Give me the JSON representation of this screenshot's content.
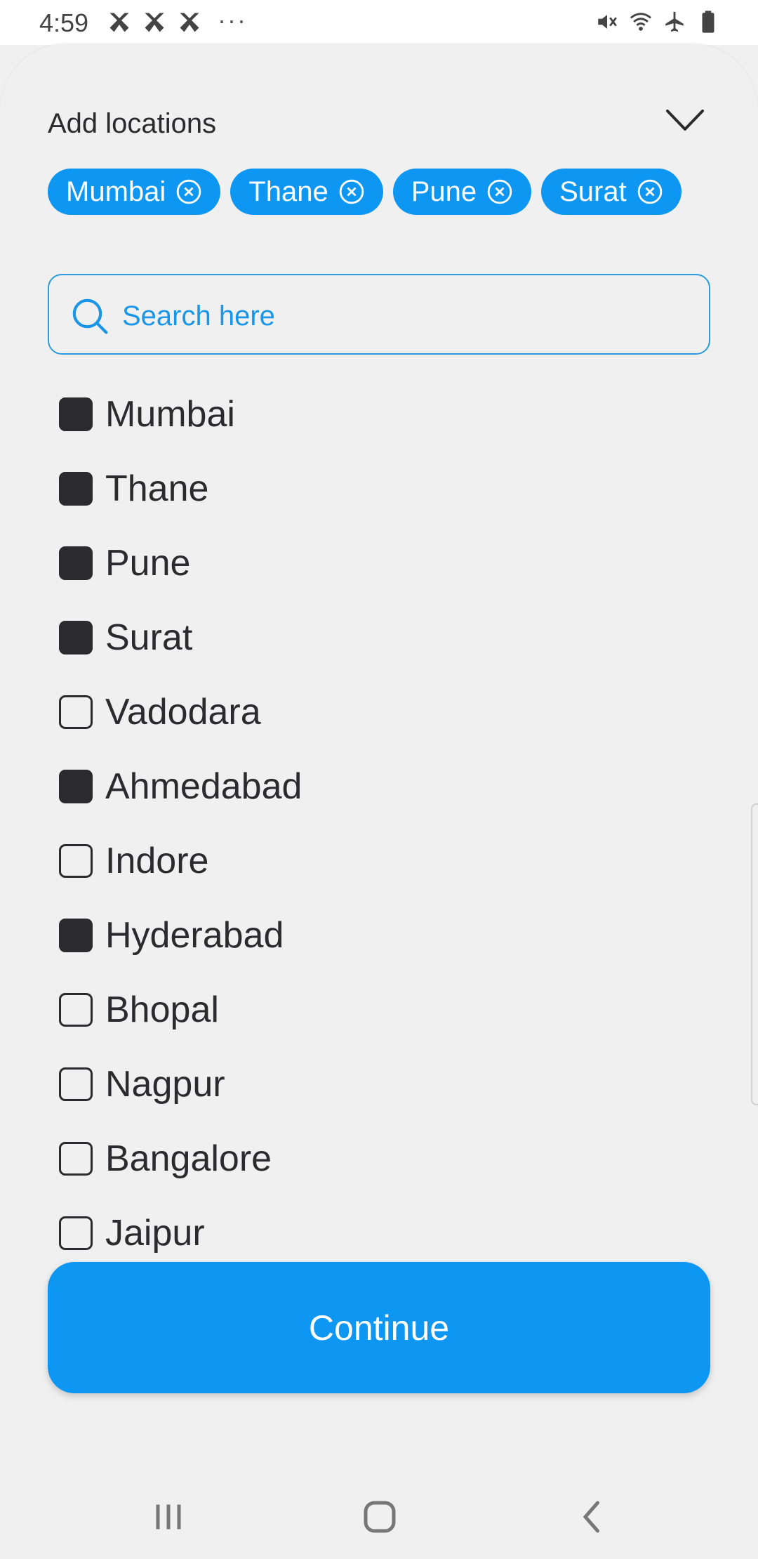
{
  "status_bar": {
    "time": "4:59",
    "notification_icons": [
      "app-notification-icon",
      "app-notification-icon",
      "app-notification-icon"
    ],
    "more_indicator": "···",
    "system_icons": [
      "mute-icon",
      "wifi-icon",
      "airplane-mode-icon",
      "battery-icon"
    ]
  },
  "sheet": {
    "title": "Add locations",
    "collapse_icon": "chevron-down-icon"
  },
  "selected_chips": [
    {
      "label": "Mumbai"
    },
    {
      "label": "Thane"
    },
    {
      "label": "Pune"
    },
    {
      "label": "Surat"
    }
  ],
  "search": {
    "placeholder": "Search here",
    "icon": "search-icon"
  },
  "locations": [
    {
      "label": "Mumbai",
      "checked": true
    },
    {
      "label": "Thane",
      "checked": true
    },
    {
      "label": "Pune",
      "checked": true
    },
    {
      "label": "Surat",
      "checked": true
    },
    {
      "label": "Vadodara",
      "checked": false
    },
    {
      "label": "Ahmedabad",
      "checked": true
    },
    {
      "label": "Indore",
      "checked": false
    },
    {
      "label": "Hyderabad",
      "checked": true
    },
    {
      "label": "Bhopal",
      "checked": false
    },
    {
      "label": "Nagpur",
      "checked": false
    },
    {
      "label": "Bangalore",
      "checked": false
    },
    {
      "label": "Jaipur",
      "checked": false
    }
  ],
  "continue_button": {
    "label": "Continue"
  },
  "colors": {
    "accent": "#0d97f2",
    "text": "#2b2b2e",
    "background": "#f0f0f0"
  },
  "nav_bar": {
    "icons": [
      "recent-apps-icon",
      "home-icon",
      "back-icon"
    ]
  }
}
